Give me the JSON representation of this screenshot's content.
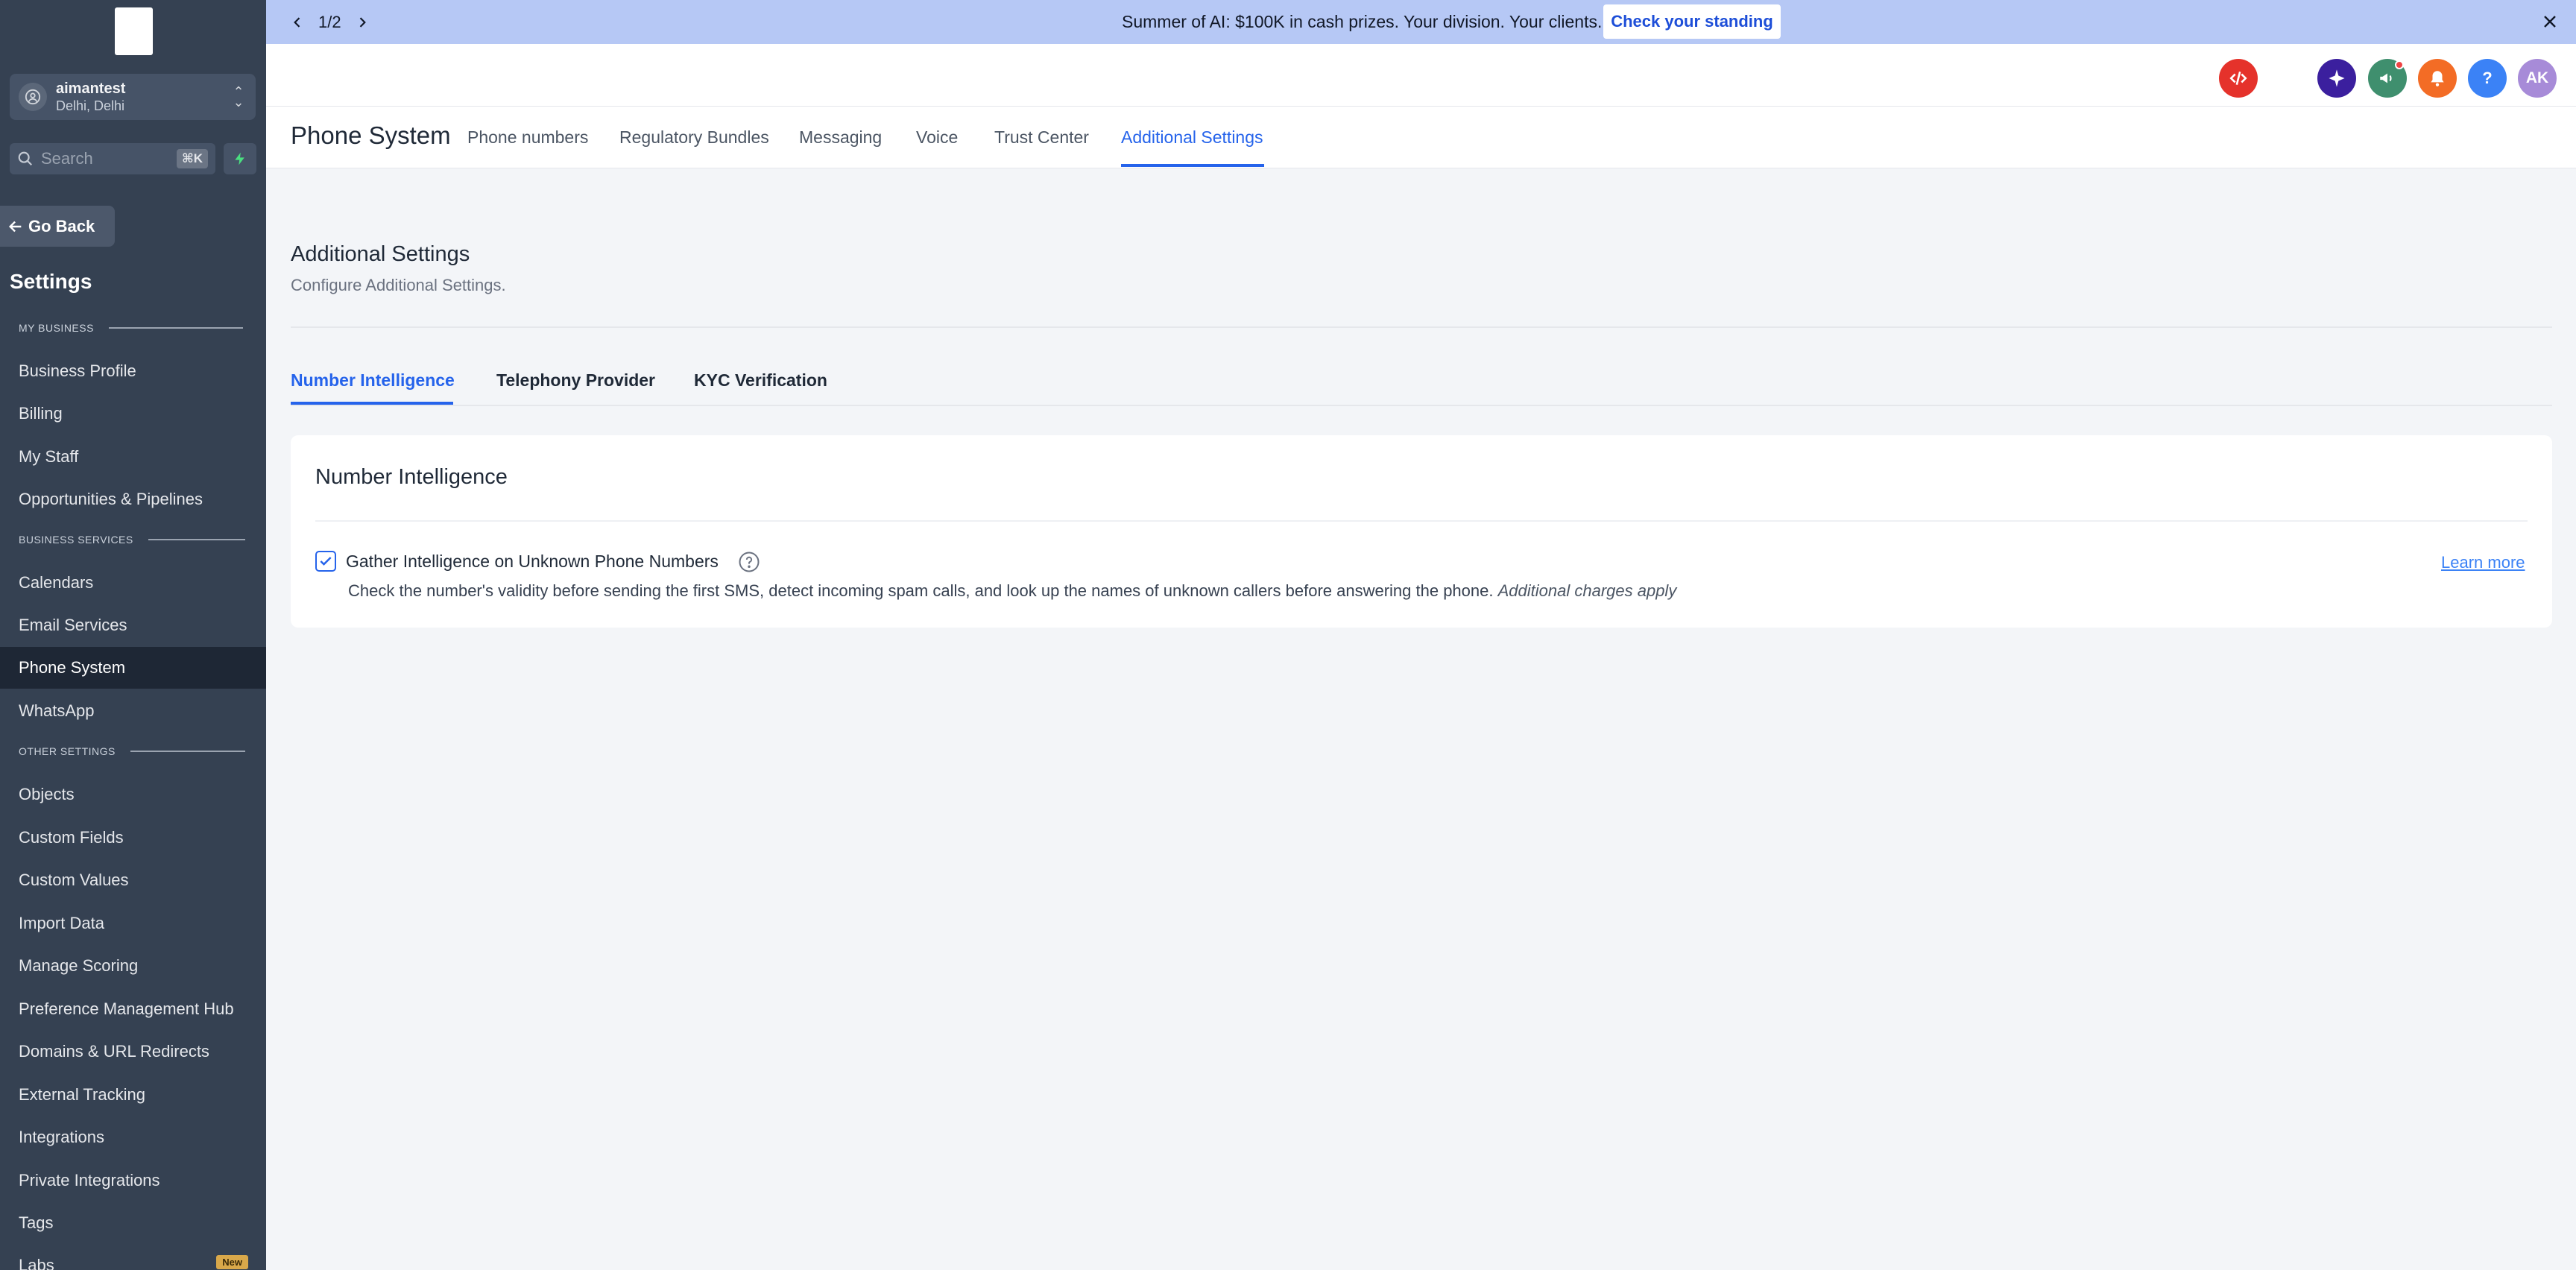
{
  "sidebar": {
    "account": {
      "name": "aimantest",
      "location": "Delhi, Delhi"
    },
    "search": {
      "placeholder": "Search",
      "shortcut": "⌘K"
    },
    "go_back": "Go Back",
    "title": "Settings",
    "sections": {
      "my_business": "MY BUSINESS",
      "business_services": "BUSINESS SERVICES",
      "other_settings": "OTHER SETTINGS"
    },
    "items": [
      "Business Profile",
      "Billing",
      "My Staff",
      "Opportunities & Pipelines",
      "Calendars",
      "Email Services",
      "Phone System",
      "WhatsApp",
      "Objects",
      "Custom Fields",
      "Custom Values",
      "Import Data",
      "Manage Scoring",
      "Preference Management Hub",
      "Domains & URL Redirects",
      "External Tracking",
      "Integrations",
      "Private Integrations",
      "Tags",
      "Labs"
    ],
    "active_item": "Phone System",
    "labs_badge": "New"
  },
  "banner": {
    "pager": "1/2",
    "message": "Summer of AI: $100K in cash prizes. Your division. Your clients.",
    "cta": "Check your standing"
  },
  "header": {
    "avatar_initials": "AK",
    "help": "?"
  },
  "tabs": {
    "title": "Phone System",
    "items": [
      "Phone numbers",
      "Regulatory Bundles",
      "Messaging",
      "Voice",
      "Trust Center",
      "Additional Settings"
    ],
    "active": "Additional Settings"
  },
  "page": {
    "heading": "Additional Settings",
    "subheading": "Configure Additional Settings.",
    "subtabs": [
      "Number Intelligence",
      "Telephony Provider",
      "KYC Verification"
    ],
    "active_subtab": "Number Intelligence"
  },
  "card": {
    "title": "Number Intelligence",
    "option": {
      "label": "Gather Intelligence on Unknown Phone Numbers",
      "checked": true,
      "description": "Check the number's validity before sending the first SMS, detect incoming spam calls, and look up the names of unknown callers before answering the phone. ",
      "description_note": "Additional charges apply",
      "learn_more": "Learn more"
    }
  },
  "colors": {
    "sidebar_bg": "#354152",
    "accent": "#2563eb",
    "banner_bg": "#b6c8f5"
  },
  "icons": [
    "user-icon",
    "search-icon",
    "bolt-icon",
    "arrow-left-icon",
    "chevron-left-icon",
    "chevron-right-icon",
    "close-icon",
    "code-icon",
    "sparkle-icon",
    "megaphone-icon",
    "bell-icon",
    "help-icon",
    "check-icon"
  ]
}
